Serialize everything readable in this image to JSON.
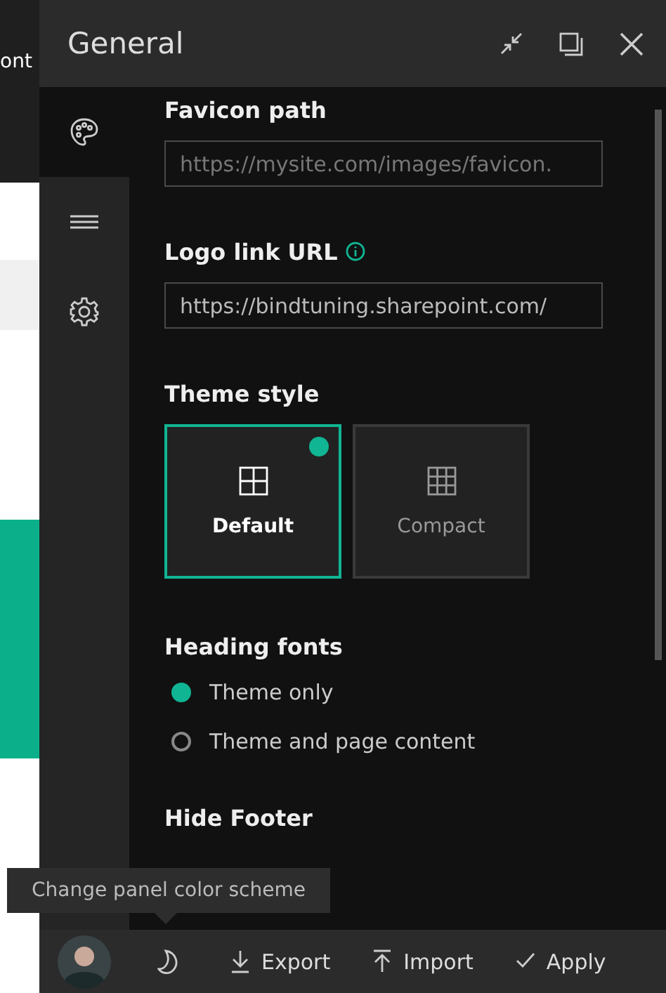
{
  "background": {
    "text": "ont"
  },
  "panel": {
    "title": "General"
  },
  "sidebar": {
    "items": [
      {
        "kind": "palette",
        "selected": true
      },
      {
        "kind": "menu",
        "selected": false
      },
      {
        "kind": "settings",
        "selected": false
      }
    ]
  },
  "fields": [
    {
      "label": "Favicon path",
      "info": false,
      "placeholder": "https://mysite.com/images/favicon."
    },
    {
      "label": "Logo link URL",
      "info": true,
      "value": "https://bindtuning.sharepoint.com/"
    }
  ],
  "theme_style": {
    "label": "Theme style",
    "options": [
      {
        "label": "Default",
        "kind": "grid2",
        "selected": true
      },
      {
        "label": "Compact",
        "kind": "grid3",
        "selected": false
      }
    ]
  },
  "heading_fonts": {
    "label": "Heading fonts",
    "options": [
      {
        "label": "Theme only",
        "selected": true
      },
      {
        "label": "Theme and page content",
        "selected": false
      }
    ]
  },
  "hide_footer": {
    "label": "Hide Footer"
  },
  "tooltip": "Change panel color scheme",
  "footer": {
    "buttons": [
      {
        "label": "Export",
        "kind": "export"
      },
      {
        "label": "Import",
        "kind": "import"
      },
      {
        "label": "Apply",
        "kind": "apply"
      }
    ]
  }
}
